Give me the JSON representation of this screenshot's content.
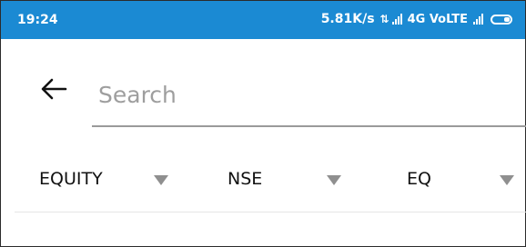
{
  "status_bar": {
    "time": "19:24",
    "net_speed": "5.81K/s",
    "network_label": "4G VoLTE",
    "icons": [
      "data-arrows-icon",
      "signal-icon",
      "signal-icon",
      "battery-icon"
    ],
    "color": "#1b8ad3"
  },
  "search": {
    "placeholder": "Search",
    "value": ""
  },
  "filters": [
    {
      "label": "EQUITY",
      "icon": "dropdown-caret-icon"
    },
    {
      "label": "NSE",
      "icon": "dropdown-caret-icon"
    },
    {
      "label": "EQ",
      "icon": "dropdown-caret-icon"
    }
  ]
}
